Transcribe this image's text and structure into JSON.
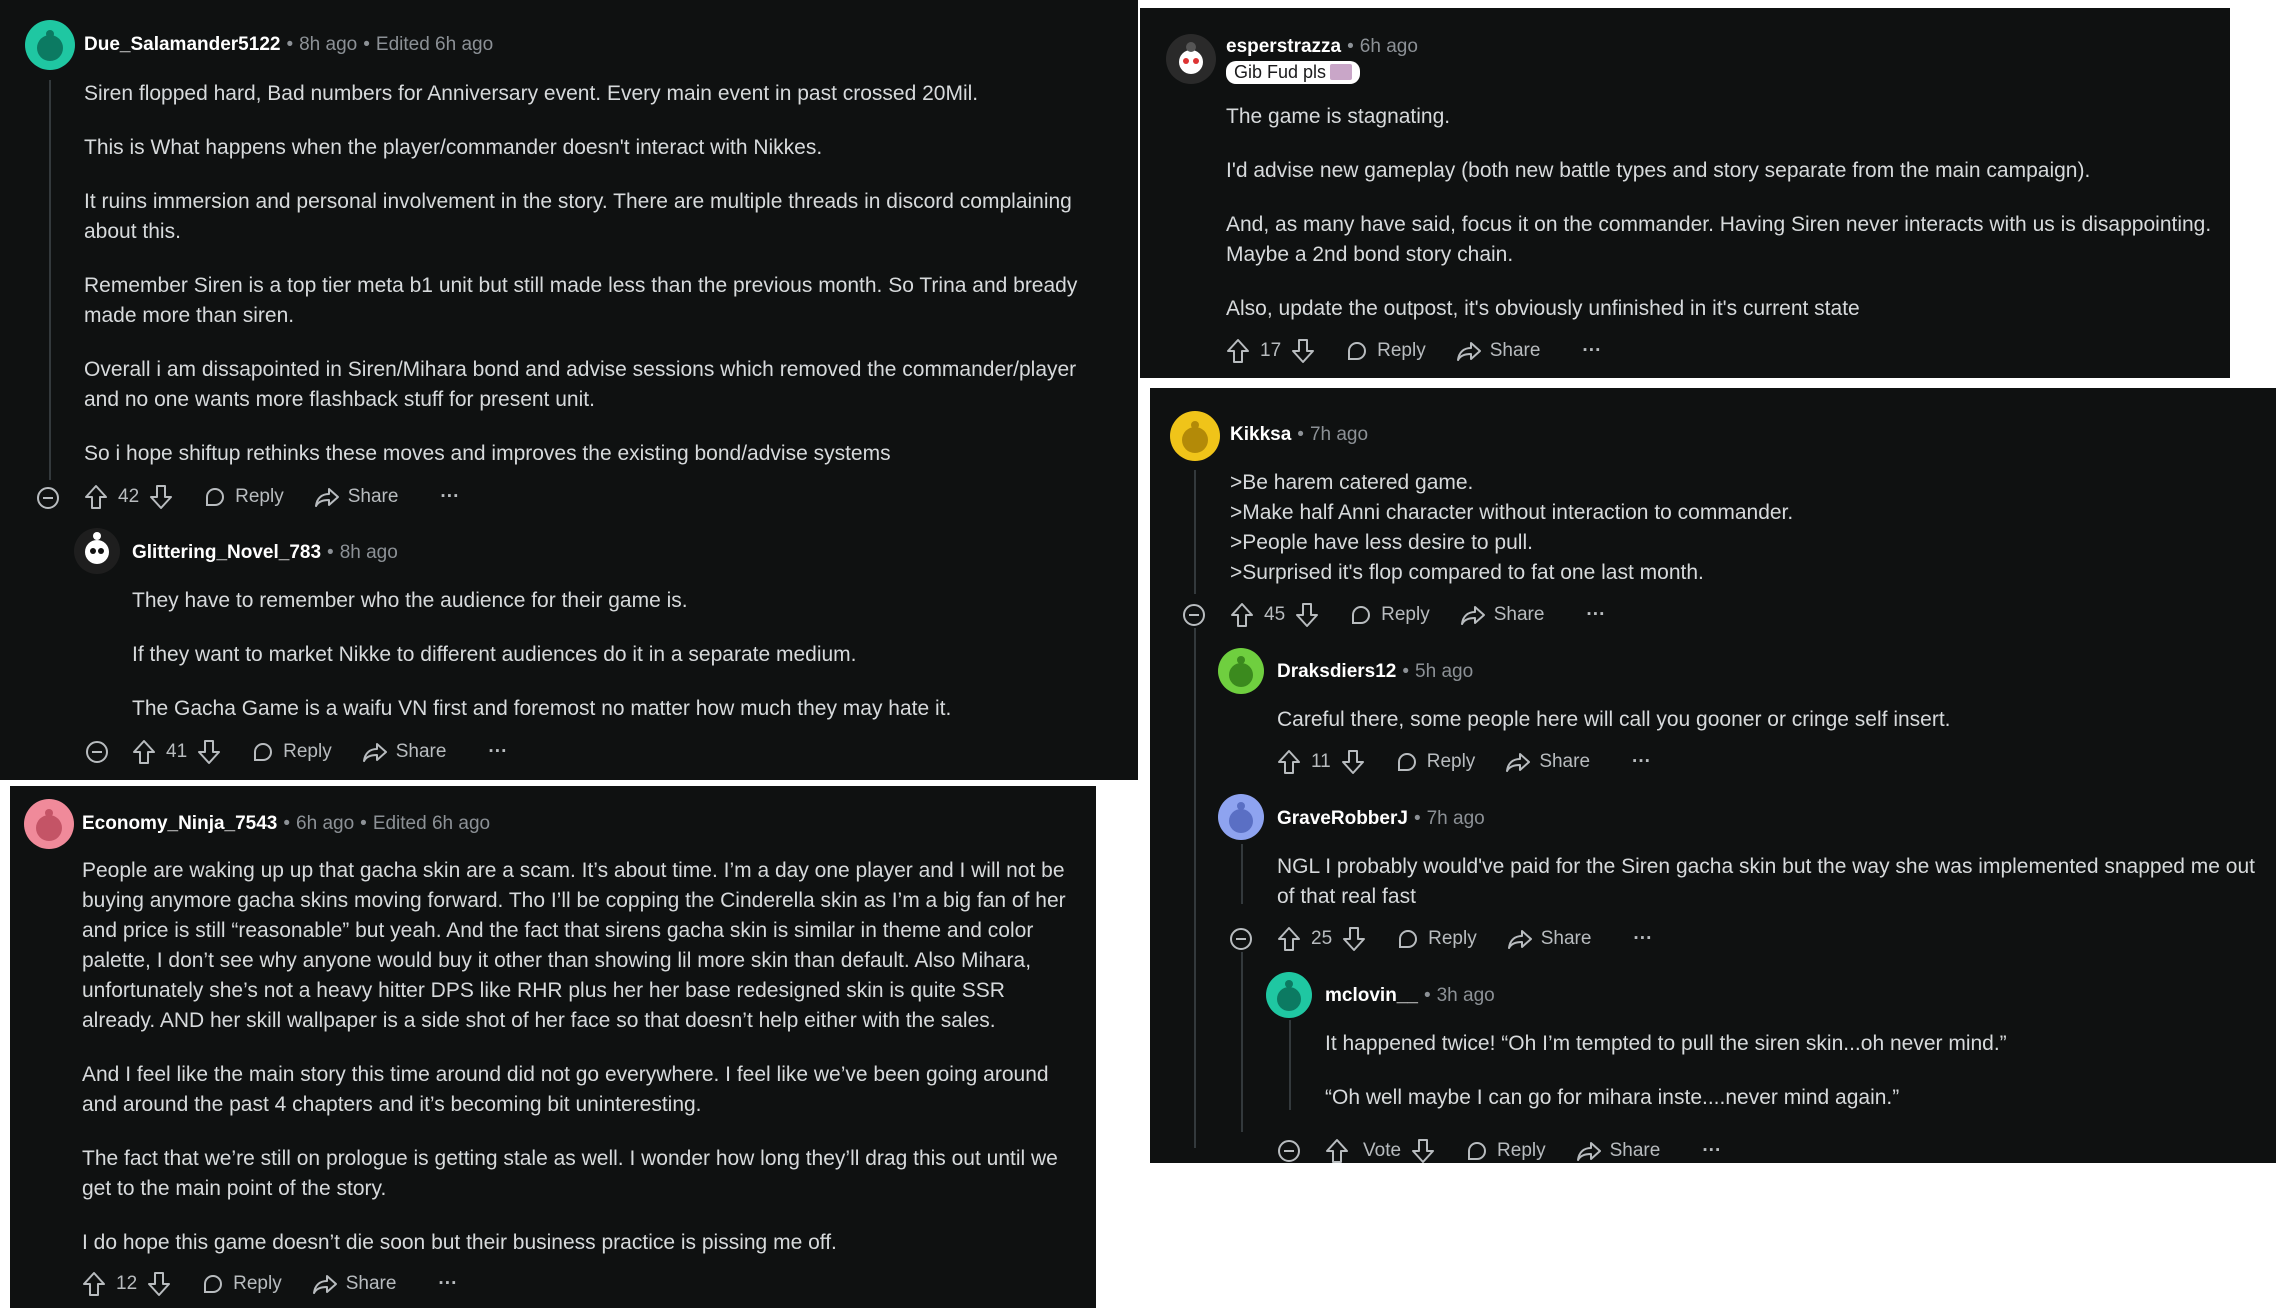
{
  "comments": {
    "due": {
      "username": "Due_Salamander5122",
      "time": "8h ago",
      "edited": "Edited 6h ago",
      "paragraphs": [
        "Siren flopped hard, Bad numbers for Anniversary event. Every main event in past crossed 20Mil.",
        "This is What happens when the player/commander doesn't interact with Nikkes.",
        "It ruins immersion and personal involvement in the story. There are multiple threads in discord complaining about this.",
        "Remember Siren is a top tier meta b1 unit but still made less than the previous month. So Trina and bready made more than siren.",
        "Overall i am dissapointed in Siren/Mihara bond and advise sessions which removed the commander/player and no one wants more flashback stuff for present unit.",
        "So i hope shiftup rethinks these moves and improves the existing bond/advise systems"
      ],
      "votes": "42",
      "avatar_color": "#1fc7a2"
    },
    "glittering": {
      "username": "Glittering_Novel_783",
      "time": "8h ago",
      "paragraphs": [
        "They have to remember who the audience for their game is.",
        "If they want to market Nikke to different audiences do it in a separate medium.",
        "The Gacha Game is a waifu VN first and foremost no matter how much they may hate it."
      ],
      "votes": "41",
      "avatar_color": "#222222"
    },
    "esper": {
      "username": "esperstrazza",
      "time": "6h ago",
      "flair": "Gib Fud pls",
      "paragraphs": [
        "The game is stagnating.",
        "I'd advise new gameplay (both new battle types and story separate from the main campaign).",
        "And, as many have said, focus it on the commander. Having Siren never interacts with us is disappointing. Maybe a 2nd bond story chain.",
        "Also, update the outpost, it's obviously unfinished in it's current state"
      ],
      "votes": "17",
      "avatar_color": "#2a2a2a"
    },
    "kikksa": {
      "username": "Kikksa",
      "time": "7h ago",
      "paragraphs": [
        ">Be harem catered game.",
        ">Make half Anni character without interaction to commander.",
        ">People have less desire to pull.",
        ">Surprised it's flop compared to fat one last month."
      ],
      "votes": "45",
      "avatar_color": "#f0c419"
    },
    "draks": {
      "username": "Draksdiers12",
      "time": "5h ago",
      "paragraphs": [
        "Careful there, some people here will call you gooner or cringe self insert."
      ],
      "votes": "11",
      "avatar_color": "#6fcf3f"
    },
    "grave": {
      "username": "GraveRobberJ",
      "time": "7h ago",
      "paragraphs": [
        "NGL I probably would've paid for the Siren gacha skin but the way she was implemented snapped me out of that real fast"
      ],
      "votes": "25",
      "avatar_color": "#8ea3f0"
    },
    "mclovin": {
      "username": "mclovin__",
      "time": "3h ago",
      "paragraphs": [
        "It happened twice! “Oh I’m tempted to pull the siren skin...oh never mind.”",
        "“Oh well maybe I can go for mihara inste....never mind again.”"
      ],
      "votes": "Vote",
      "avatar_color": "#1fc7a2"
    },
    "economy": {
      "username": "Economy_Ninja_7543",
      "time": "6h ago",
      "edited": "Edited 6h ago",
      "paragraphs": [
        "People are waking up up that gacha skin are a scam. It’s about time. I’m a day one player and I will not be buying anymore gacha skins moving forward. Tho I’ll be copping the Cinderella skin as I’m a big fan of her and price is still “reasonable” but yeah. And the fact that sirens gacha skin is similar in theme and color palette, I don’t see why anyone would buy it other than showing lil more skin than default. Also Mihara, unfortunately she’s not a heavy hitter DPS like RHR plus her her base redesigned skin is quite SSR already. AND her skill wallpaper is a side shot of her face so that doesn’t help either with the sales.",
        "And I feel like the main story this time around did not go everywhere. I feel like we’ve been going around and around the past 4 chapters and it’s becoming bit uninteresting.",
        "The fact that we’re still on prologue is getting stale as well. I wonder how long they’ll drag this out until we get to the main point of the story.",
        "I do hope this game doesn’t die soon but their business practice is pissing me off."
      ],
      "votes": "12",
      "avatar_color": "#f08a9a"
    }
  },
  "labels": {
    "reply": "Reply",
    "share": "Share",
    "more": "···",
    "sep": "•"
  }
}
